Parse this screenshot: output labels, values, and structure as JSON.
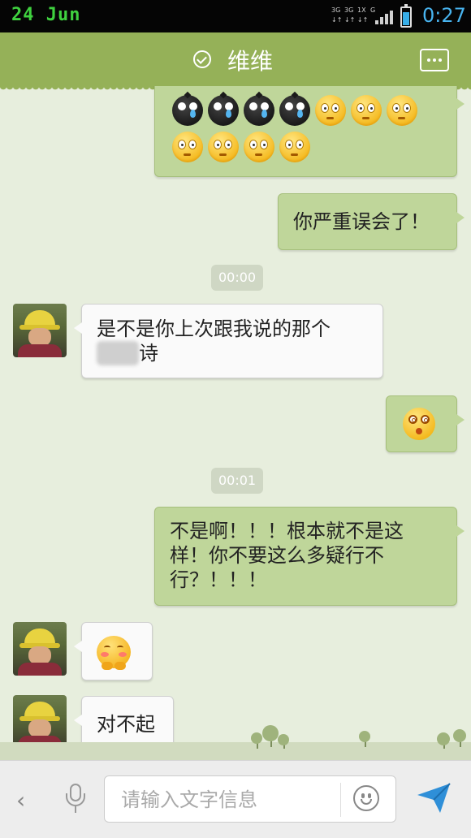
{
  "status_bar": {
    "date": "24 Jun",
    "network_labels": [
      "3G",
      "3G",
      "1X",
      "G"
    ],
    "time": "0:27",
    "battery_color": "#37aee9"
  },
  "header": {
    "title": "维维",
    "verified_icon": "check-circle-icon",
    "menu_icon": "more-dots-icon",
    "background": "#95b158"
  },
  "messages": [
    {
      "id": "m1",
      "direction": "out",
      "type": "emoji-grid",
      "emojis": [
        "crying-black",
        "crying-black",
        "crying-black",
        "crying-black",
        "blank-face",
        "blank-face",
        "blank-face",
        "blank-face",
        "blank-face",
        "blank-face",
        "blank-face"
      ]
    },
    {
      "id": "m2",
      "direction": "out",
      "type": "text",
      "text": "你严重误会了！"
    },
    {
      "id": "t1",
      "type": "timestamp",
      "text": "00:00"
    },
    {
      "id": "m3",
      "direction": "in",
      "type": "text",
      "line1": "是不是你上次跟我说的那个",
      "line2": "诗"
    },
    {
      "id": "m4",
      "direction": "out",
      "type": "emoji",
      "emoji": "dizzy-face"
    },
    {
      "id": "t2",
      "type": "timestamp",
      "text": "00:01"
    },
    {
      "id": "m5",
      "direction": "out",
      "type": "text",
      "line1": "不是啊！！！根本就不是这",
      "line2": "样！你不要这么多疑行不",
      "line3": "行？！！！"
    },
    {
      "id": "m6",
      "direction": "in",
      "type": "emoji",
      "emoji": "shy-face"
    },
    {
      "id": "m7",
      "direction": "in",
      "type": "text",
      "text": "对不起"
    }
  ],
  "input_bar": {
    "placeholder": "请输入文字信息",
    "value": "",
    "back_icon": "chevron-left-icon",
    "voice_icon": "microphone-icon",
    "emoji_icon": "smiley-icon",
    "send_icon": "send-arrow-icon",
    "send_color": "#2f8fd8"
  }
}
